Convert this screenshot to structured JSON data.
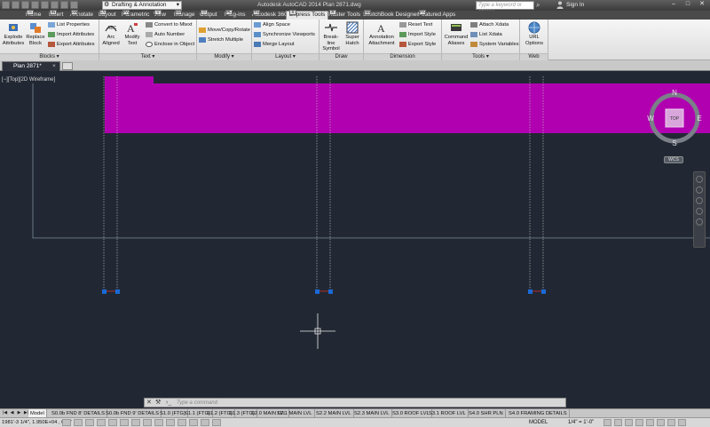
{
  "titlebar": {
    "workspace": "Drafting & Annotation",
    "app_title": "Autodesk AutoCAD 2014   Plan 2871.dwg",
    "search_placeholder": "Type a keyword or phrase",
    "sign_in": "Sign In"
  },
  "ribbon_tabs": [
    {
      "label": "Home",
      "key": "H"
    },
    {
      "label": "Insert",
      "key": "IN"
    },
    {
      "label": "Annotate",
      "key": "AN"
    },
    {
      "label": "Layout",
      "key": "LY"
    },
    {
      "label": "Parametric",
      "key": "PA"
    },
    {
      "label": "View",
      "key": "V"
    },
    {
      "label": "Manage",
      "key": "MA"
    },
    {
      "label": "Output",
      "key": "O"
    },
    {
      "label": "Plug-ins",
      "key": "PL"
    },
    {
      "label": "Autodesk 360",
      "key": "TS"
    },
    {
      "label": "Express Tools",
      "key": "X"
    },
    {
      "label": "Raster Tools",
      "key": "R"
    },
    {
      "label": "SketchBook Designer",
      "key": "SD"
    },
    {
      "label": "Featured Apps",
      "key": "FA"
    }
  ],
  "ribbon": {
    "blocks": {
      "title": "Blocks",
      "explode_attributes": "Explode Attributes",
      "replace_block": "Replace Block",
      "list_properties": "List Properties",
      "import_attributes": "Import Attributes",
      "export_attributes": "Export Attributes"
    },
    "text": {
      "title": "Text",
      "arc_aligned": "Arc Aligned",
      "modify_text": "Modify Text",
      "convert_to_mtext": "Convert to Mtext",
      "auto_number": "Auto Number",
      "enclose_in_object": "Enclose in Object"
    },
    "modify": {
      "title": "Modify",
      "move_copy_rotate": "Move/Copy/Rotate",
      "stretch_multiple": "Stretch Multiple"
    },
    "layout": {
      "title": "Layout",
      "align_space": "Align Space",
      "synchronize_viewports": "Synchronize Viewports",
      "merge_layout": "Merge Layout"
    },
    "draw": {
      "title": "Draw",
      "break_line_symbol": "Break-line Symbol",
      "super_hatch": "Super Hatch"
    },
    "dimension": {
      "title": "Dimension",
      "annotation_attachment": "Annotation Attachment",
      "reset_text": "Reset Text",
      "import_style": "Import Style",
      "export_style": "Export Style"
    },
    "tools": {
      "title": "Tools",
      "command_aliases": "Command Aliases",
      "attach_xdata": "Attach Xdata",
      "list_xdata": "List Xdata",
      "system_variables": "System Variables"
    },
    "web": {
      "title": "Web",
      "url_options": "URL Options"
    }
  },
  "file_tab": {
    "label": "Plan 2871*"
  },
  "viewport": {
    "label": "[−][Top][2D Wireframe]",
    "highlight_color": "#b000b0",
    "background_color": "#222833"
  },
  "viewcube": {
    "north": "N",
    "south": "S",
    "east": "E",
    "west": "W",
    "face": "TOP",
    "wcs": "WCS"
  },
  "command_line": {
    "placeholder": "Type a command"
  },
  "layout_tabs": [
    "Model",
    "S0.0b FND 8' DETAILS",
    "S0.0b FND 9' DETAILS",
    "S1.0 (FTG)",
    "S1.1 (FTG)",
    "S1.2 (FTG)",
    "S1.3 (FTG)",
    "S2.0 MAIN LVL",
    "S2.1 MAIN LVL",
    "S2.2 MAIN LVL",
    "S2.3 MAIN LVL",
    "S3.0 ROOF LVL",
    "S3.1 ROOF LVL",
    "S4.0 SHR PLN",
    "S4.0 FRAMING DETAILS"
  ],
  "status_bar": {
    "coordinates": "1981'-3 1/4\", 1.950E+04  , 0'-0\"",
    "model": "MODEL",
    "scale": "1/4\" = 1'-0\""
  }
}
